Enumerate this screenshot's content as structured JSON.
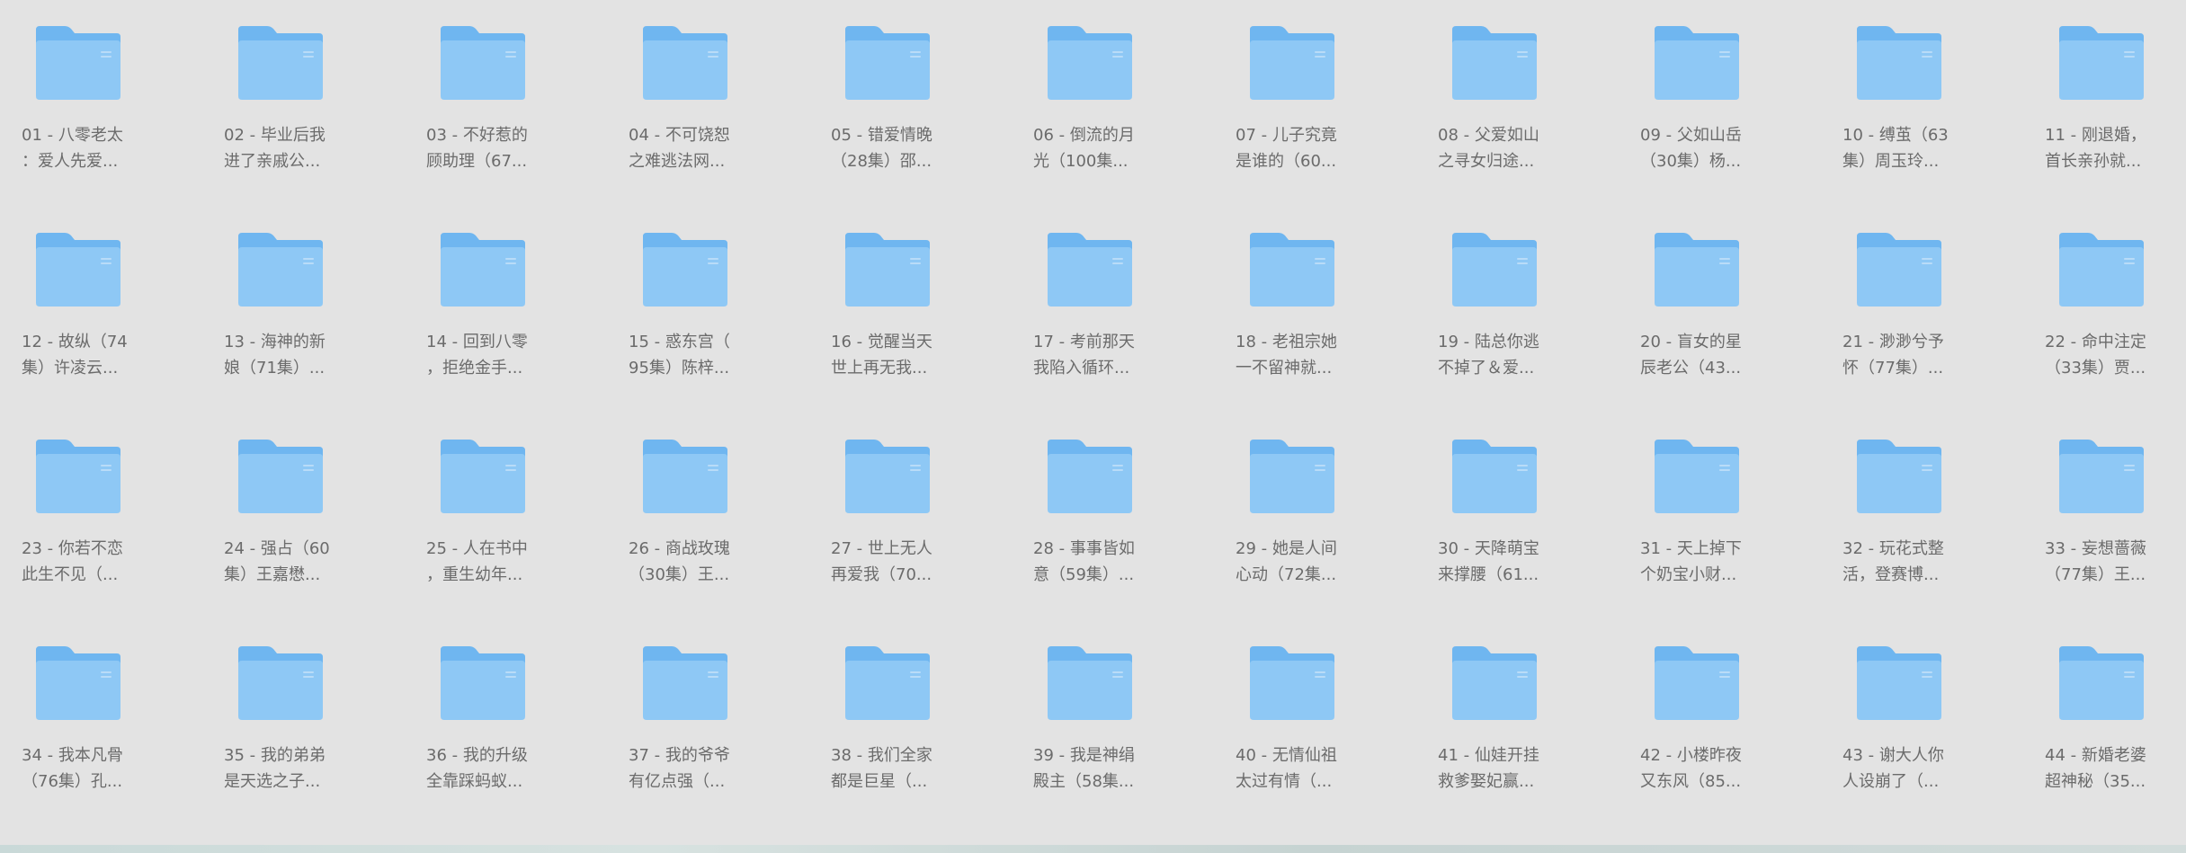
{
  "folder_icon": "folder-icon",
  "colors": {
    "background": "#e3e3e3",
    "folder_front": "#8ec8f5",
    "folder_back": "#6fb6f0",
    "label_text": "#6b6b6b"
  },
  "folders": [
    {
      "line1": "01 - 八零老太",
      "line2": "：爱人先爱..."
    },
    {
      "line1": "02 - 毕业后我",
      "line2": "进了亲戚公..."
    },
    {
      "line1": "03 - 不好惹的",
      "line2": "顾助理（67..."
    },
    {
      "line1": "04 - 不可饶恕",
      "line2": "之难逃法网..."
    },
    {
      "line1": "05 - 错爱情晚",
      "line2": "（28集）邵..."
    },
    {
      "line1": "06 - 倒流的月",
      "line2": "光（100集..."
    },
    {
      "line1": "07 - 儿子究竟",
      "line2": "是谁的（60..."
    },
    {
      "line1": "08 - 父爱如山",
      "line2": "之寻女归途..."
    },
    {
      "line1": "09 - 父如山岳",
      "line2": "（30集）杨..."
    },
    {
      "line1": "10 - 缚茧（63",
      "line2": "集）周玉玲..."
    },
    {
      "line1": "11 - 刚退婚，",
      "line2": "首长亲孙就..."
    },
    {
      "line1": "12 - 故纵（74",
      "line2": "集）许凌云..."
    },
    {
      "line1": "13 - 海神的新",
      "line2": "娘（71集）..."
    },
    {
      "line1": "14 - 回到八零",
      "line2": "，拒绝金手..."
    },
    {
      "line1": "15 - 惑东宫（",
      "line2": "95集）陈梓..."
    },
    {
      "line1": "16 - 觉醒当天",
      "line2": "世上再无我..."
    },
    {
      "line1": "17 - 考前那天",
      "line2": "我陷入循环..."
    },
    {
      "line1": "18 - 老祖宗她",
      "line2": "一不留神就..."
    },
    {
      "line1": "19 - 陆总你逃",
      "line2": "不掉了＆爱..."
    },
    {
      "line1": "20 - 盲女的星",
      "line2": "辰老公（43..."
    },
    {
      "line1": "21 - 渺渺兮予",
      "line2": "怀（77集）..."
    },
    {
      "line1": "22 - 命中注定",
      "line2": "（33集）贾..."
    },
    {
      "line1": "23 - 你若不恋",
      "line2": "此生不见（..."
    },
    {
      "line1": "24 - 强占（60",
      "line2": "集）王嘉懋..."
    },
    {
      "line1": "25 - 人在书中",
      "line2": "，重生幼年..."
    },
    {
      "line1": "26 - 商战玫瑰",
      "line2": "（30集）王..."
    },
    {
      "line1": "27 - 世上无人",
      "line2": "再爱我（70..."
    },
    {
      "line1": "28 - 事事皆如",
      "line2": "意（59集）..."
    },
    {
      "line1": "29 - 她是人间",
      "line2": "心动（72集..."
    },
    {
      "line1": "30 - 天降萌宝",
      "line2": "来撑腰（61..."
    },
    {
      "line1": "31 - 天上掉下",
      "line2": "个奶宝小财..."
    },
    {
      "line1": "32 - 玩花式整",
      "line2": "活，登赛博..."
    },
    {
      "line1": "33 - 妄想蔷薇",
      "line2": "（77集）王..."
    },
    {
      "line1": "34 - 我本凡骨",
      "line2": "（76集）孔..."
    },
    {
      "line1": "35 - 我的弟弟",
      "line2": "是天选之子..."
    },
    {
      "line1": "36 - 我的升级",
      "line2": "全靠踩蚂蚁..."
    },
    {
      "line1": "37 - 我的爷爷",
      "line2": "有亿点强（..."
    },
    {
      "line1": "38 - 我们全家",
      "line2": "都是巨星（..."
    },
    {
      "line1": "39 - 我是神绢",
      "line2": "殿主（58集..."
    },
    {
      "line1": "40 - 无情仙祖",
      "line2": "太过有情（..."
    },
    {
      "line1": "41 - 仙娃开挂",
      "line2": "救爹娶妃赢..."
    },
    {
      "line1": "42 - 小楼昨夜",
      "line2": "又东风（85..."
    },
    {
      "line1": "43 - 谢大人你",
      "line2": "人设崩了（..."
    },
    {
      "line1": "44 - 新婚老婆",
      "line2": "超神秘（35..."
    }
  ]
}
